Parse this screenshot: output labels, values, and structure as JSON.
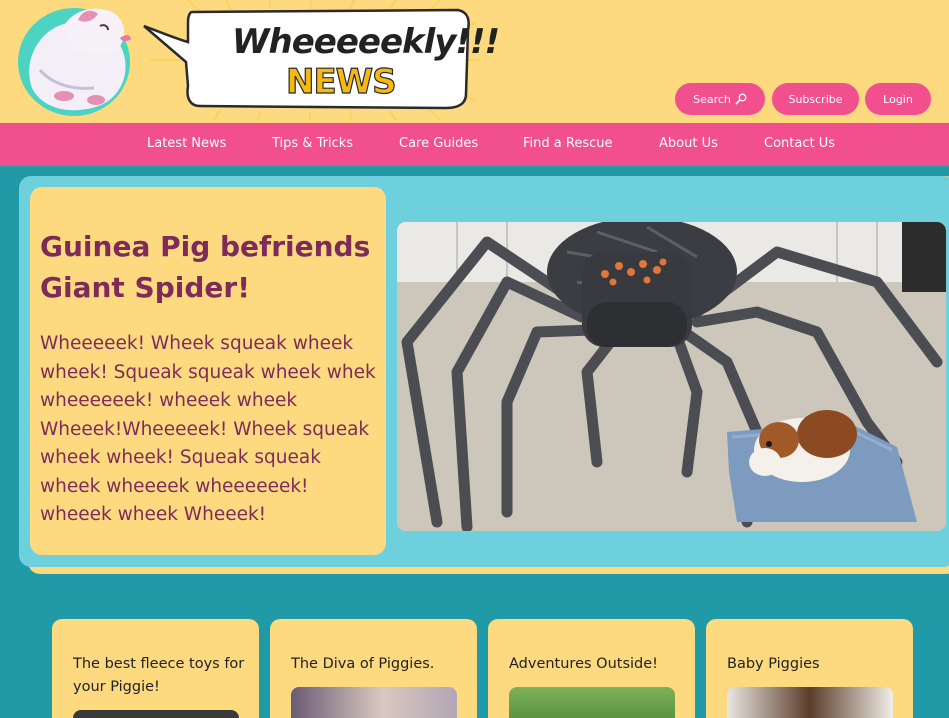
{
  "header": {
    "logo_line1": "Wheeeeekly!!!",
    "logo_line2": "NEWS",
    "buttons": {
      "search": "Search",
      "subscribe": "Subscribe",
      "login": "Login"
    }
  },
  "nav": {
    "items": [
      {
        "label": "Latest News"
      },
      {
        "label": "Tips & Tricks"
      },
      {
        "label": "Care Guides"
      },
      {
        "label": "Find a Rescue"
      },
      {
        "label": "About Us"
      },
      {
        "label": "Contact Us"
      }
    ]
  },
  "hero": {
    "title": "Guinea Pig befriends Giant Spider!",
    "body": "Wheeeeek! Wheek squeak wheek wheek! Squeak squeak wheek whek wheeeeeek! wheeek wheek Wheeek!Wheeeeek! Wheek squeak wheek wheek! Squeak squeak wheek wheeeek wheeeeeek! wheeek wheek Wheeek!"
  },
  "cards": [
    {
      "title": "The best fleece toys for your Piggie!"
    },
    {
      "title": "The Diva of Piggies."
    },
    {
      "title": "Adventures Outside!"
    },
    {
      "title": "Baby Piggies"
    }
  ],
  "colors": {
    "yellow": "#fdd97f",
    "pink": "#f24f8f",
    "teal": "#1f9aa6",
    "light_teal": "#6fd0dd",
    "plum": "#7e2b5a"
  },
  "icons": {
    "search": "magnifier-icon"
  }
}
